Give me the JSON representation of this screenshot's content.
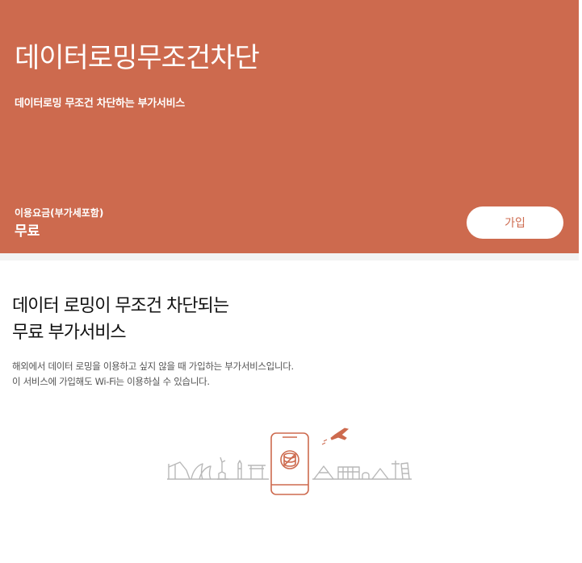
{
  "hero": {
    "title": "데이터로밍무조건차단",
    "subtitle": "데이터로밍 무조건 차단하는 부가서비스",
    "fee_label": "이용요금(부가세포함)",
    "fee_value": "무료",
    "join_label": "가입",
    "background_color": "#cd6a4e"
  },
  "content": {
    "title_line1": "데이터 로밍이 무조건 차단되는",
    "title_line2": "무료 부가서비스",
    "desc_line1": "해외에서 데이터 로밍을 이용하고 싶지 않을 때 가입하는 부가서비스입니다.",
    "desc_line2": "이 서비스에 가입해도 Wi-Fi는 이용하실 수 있습니다."
  },
  "illustration": {
    "icons": [
      "phone-blocked-data-icon",
      "airplane-icon",
      "world-landmarks-skyline-icon"
    ],
    "accent_color": "#cd6a4e",
    "skyline_color": "#b8b8b8"
  }
}
